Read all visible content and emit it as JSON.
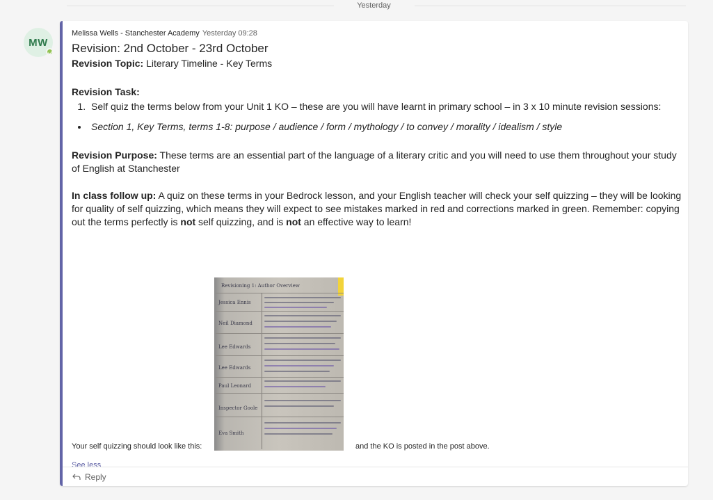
{
  "thread": {
    "date_divider": "Yesterday"
  },
  "message": {
    "avatar_initials": "MW",
    "author": "Melissa Wells - Stanchester Academy",
    "timestamp": "Yesterday 09:28",
    "subject": "Revision: 2nd October - 23rd October",
    "topic_label": "Revision Topic:",
    "topic_value": " Literary Timeline - Key Terms",
    "task_heading": "Revision Task:",
    "task_items": [
      "Self quiz the terms below from your Unit 1 KO – these are you will have learnt in primary school – in 3 x 10 minute revision sessions:"
    ],
    "task_bullets": [
      "Section 1, Key Terms, terms 1-8: purpose / audience / form / mythology / to convey / morality / idealism / style"
    ],
    "purpose_label": "Revision Purpose:",
    "purpose_text": " These terms are an essential part of the language of a literary critic and you will need to use them throughout your study of English at Stanchester",
    "followup_label": "In class follow up:",
    "followup_text": " A quiz on these terms in your Bedrock lesson, and your English teacher will check your self quizzing – they will be looking for quality of self quizzing, which means they will expect to see mistakes marked in red and corrections marked in green. Remember: copying out the terms perfectly is ",
    "followup_not_1": "not",
    "followup_mid": " self quizzing, and is ",
    "followup_not_2": "not",
    "followup_end": " an effective way to learn!",
    "selfquiz_before": "Your self quizzing should look like this:",
    "selfquiz_after": "and the KO is posted in the post above.",
    "see_less": "See less",
    "reply_label": "Reply"
  },
  "notebook_image": {
    "header": "Revisioning 1: Author Overview",
    "rows": [
      "Jessica Ennis",
      "Neil Diamond",
      "Lee Edwards",
      "Lee Edwards",
      "Paul Leonard",
      "Inspector Goole",
      "Eva Smith"
    ]
  },
  "colors": {
    "accent": "#6264a7",
    "presence": "#92c353",
    "avatar_bg": "#dff0e4",
    "avatar_text": "#2f7a4c"
  },
  "icons": {
    "reply": "reply-arrow-icon",
    "presence": "presence-available-icon"
  }
}
